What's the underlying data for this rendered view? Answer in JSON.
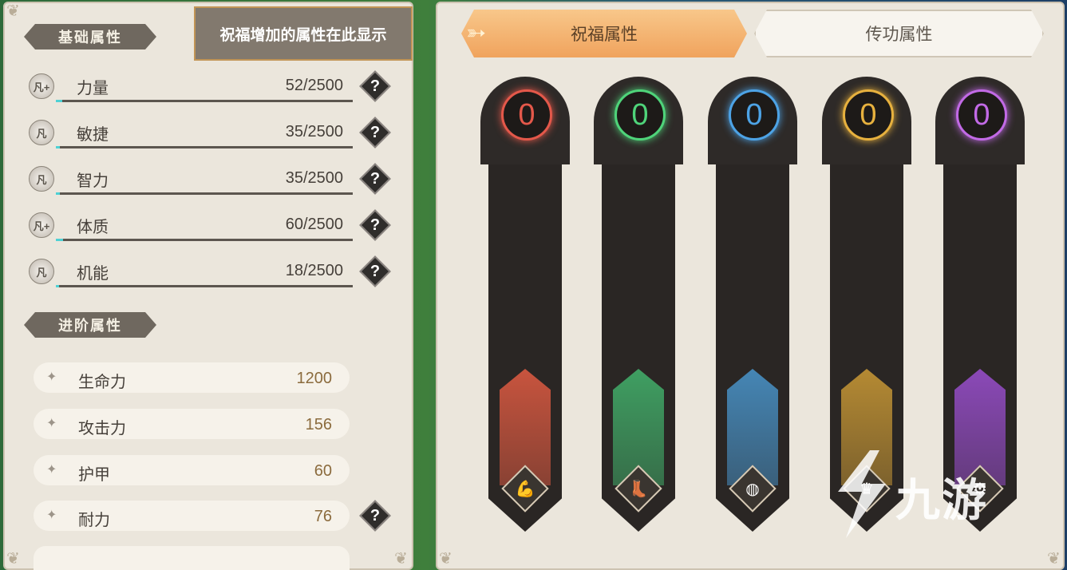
{
  "left": {
    "tooltip": "祝福增加的属性在此显示",
    "basic_header": "基础属性",
    "basic_attrs": [
      {
        "name": "力量",
        "value": "52/2500",
        "badge": "凡+",
        "progress": 0.0208
      },
      {
        "name": "敏捷",
        "value": "35/2500",
        "badge": "凡",
        "progress": 0.014
      },
      {
        "name": "智力",
        "value": "35/2500",
        "badge": "凡",
        "progress": 0.014
      },
      {
        "name": "体质",
        "value": "60/2500",
        "badge": "凡+",
        "progress": 0.024
      },
      {
        "name": "机能",
        "value": "18/2500",
        "badge": "凡",
        "progress": 0.0072
      }
    ],
    "advanced_header": "进阶属性",
    "advanced_attrs": [
      {
        "name": "生命力",
        "value": "1200"
      },
      {
        "name": "攻击力",
        "value": "156"
      },
      {
        "name": "护甲",
        "value": "60"
      },
      {
        "name": "耐力",
        "value": "76"
      }
    ],
    "help_symbol": "?"
  },
  "tabs": {
    "active": "祝福属性",
    "inactive": "传功属性"
  },
  "pillars": [
    {
      "count": "0",
      "color": "#e4584a",
      "crystal": "#c8543e",
      "icon": "flexed-arm-icon",
      "glyph": "💪"
    },
    {
      "count": "0",
      "color": "#4fd47a",
      "crystal": "#3f9f62",
      "icon": "boot-icon",
      "glyph": "👢"
    },
    {
      "count": "0",
      "color": "#4da3e6",
      "crystal": "#4586b5",
      "icon": "brain-head-icon",
      "glyph": "◍"
    },
    {
      "count": "0",
      "color": "#e7b13e",
      "crystal": "#b58a33",
      "icon": "crown-icon",
      "glyph": "♛"
    },
    {
      "count": "0",
      "color": "#c26ae6",
      "crystal": "#8b49b8",
      "icon": "gear-orb-icon",
      "glyph": "⚙"
    }
  ],
  "watermark": {
    "text": "九游"
  },
  "colors": {
    "progress": "#4fd1d4",
    "tab_active": "#f0a35d"
  }
}
